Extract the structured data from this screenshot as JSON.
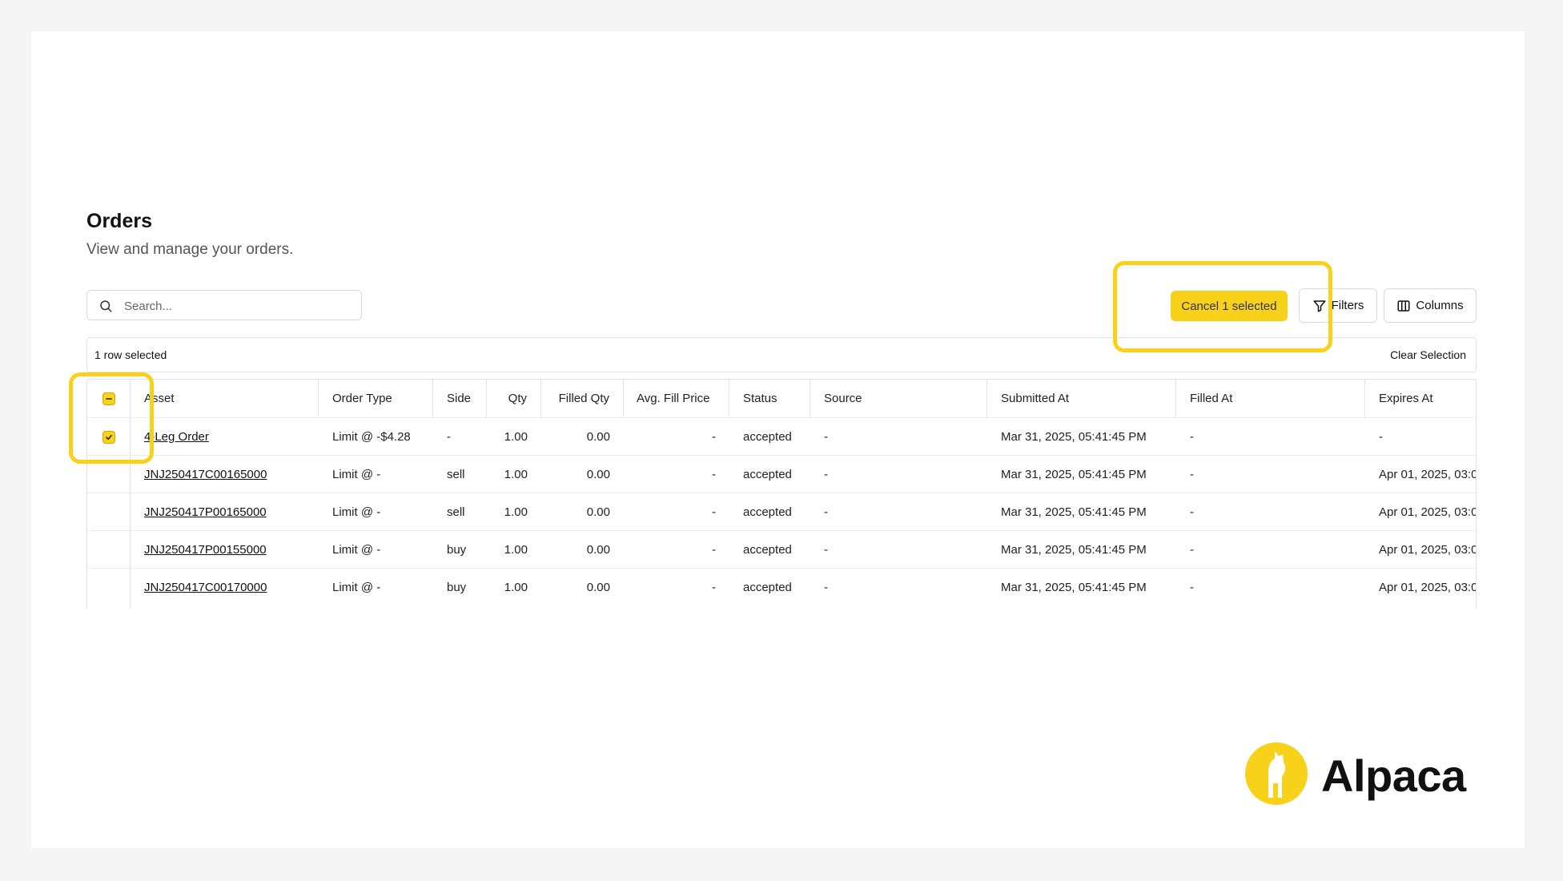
{
  "page": {
    "title": "Orders",
    "subtitle": "View and manage your orders."
  },
  "search": {
    "placeholder": "Search..."
  },
  "toolbar": {
    "cancel_label": "Cancel 1 selected",
    "filters_label": "Filters",
    "columns_label": "Columns"
  },
  "selection": {
    "count_text": "1 row selected",
    "clear_label": "Clear Selection"
  },
  "table": {
    "headers": {
      "asset": "Asset",
      "order_type": "Order Type",
      "side": "Side",
      "qty": "Qty",
      "filled_qty": "Filled Qty",
      "avg_fill_price": "Avg. Fill Price",
      "status": "Status",
      "source": "Source",
      "submitted_at": "Submitted At",
      "filled_at": "Filled At",
      "expires_at": "Expires At"
    },
    "rows": [
      {
        "asset": "4-Leg Order",
        "order_type": "Limit @ -$4.28",
        "side": "-",
        "qty": "1.00",
        "filled_qty": "0.00",
        "avg_fill_price": "-",
        "status": "accepted",
        "source": "-",
        "submitted_at": "Mar 31, 2025, 05:41:45 PM",
        "filled_at": "-",
        "expires_at": "-"
      },
      {
        "asset": "JNJ250417C00165000",
        "order_type": "Limit @ -",
        "side": "sell",
        "qty": "1.00",
        "filled_qty": "0.00",
        "avg_fill_price": "-",
        "status": "accepted",
        "source": "-",
        "submitted_at": "Mar 31, 2025, 05:41:45 PM",
        "filled_at": "-",
        "expires_at": "Apr 01, 2025, 03:0"
      },
      {
        "asset": "JNJ250417P00165000",
        "order_type": "Limit @ -",
        "side": "sell",
        "qty": "1.00",
        "filled_qty": "0.00",
        "avg_fill_price": "-",
        "status": "accepted",
        "source": "-",
        "submitted_at": "Mar 31, 2025, 05:41:45 PM",
        "filled_at": "-",
        "expires_at": "Apr 01, 2025, 03:0"
      },
      {
        "asset": "JNJ250417P00155000",
        "order_type": "Limit @ -",
        "side": "buy",
        "qty": "1.00",
        "filled_qty": "0.00",
        "avg_fill_price": "-",
        "status": "accepted",
        "source": "-",
        "submitted_at": "Mar 31, 2025, 05:41:45 PM",
        "filled_at": "-",
        "expires_at": "Apr 01, 2025, 03:0"
      },
      {
        "asset": "JNJ250417C00170000",
        "order_type": "Limit @ -",
        "side": "buy",
        "qty": "1.00",
        "filled_qty": "0.00",
        "avg_fill_price": "-",
        "status": "accepted",
        "source": "-",
        "submitted_at": "Mar 31, 2025, 05:41:45 PM",
        "filled_at": "-",
        "expires_at": "Apr 01, 2025, 03:0"
      }
    ]
  },
  "brand": {
    "name": "Alpaca",
    "accent": "#f8d11b"
  },
  "icons": {
    "search": "search-icon",
    "filter": "filter-icon",
    "columns": "columns-icon",
    "check": "check-icon",
    "indeterminate": "minus-icon"
  }
}
